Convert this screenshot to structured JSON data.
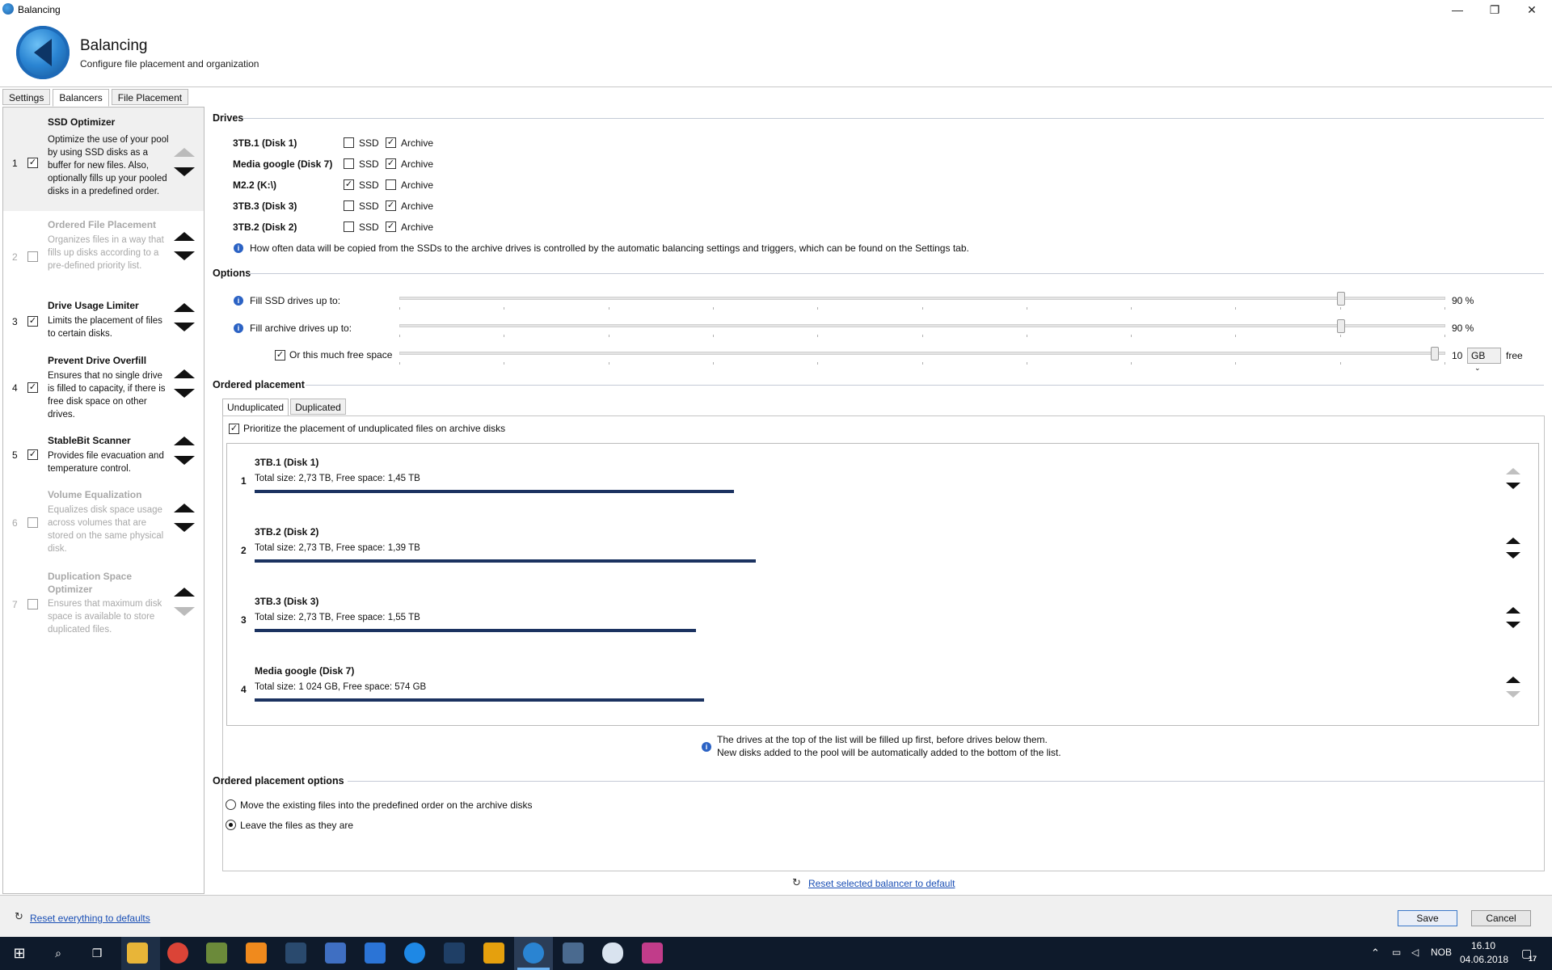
{
  "window": {
    "title": "Balancing",
    "minimize": "—",
    "maximize": "❐",
    "close": "✕"
  },
  "header": {
    "title": "Balancing",
    "subtitle": "Configure file placement and organization"
  },
  "tabs": [
    "Settings",
    "Balancers",
    "File Placement"
  ],
  "active_tab": "Balancers",
  "balancers": [
    {
      "num": "1",
      "title": "SSD Optimizer",
      "desc": "Optimize the use of your pool by using SSD disks as a buffer for new files. Also, optionally fills up your pooled disks in a predefined order.",
      "checked": true,
      "enabled": true
    },
    {
      "num": "2",
      "title": "Ordered File Placement",
      "desc": "Organizes files in a way that fills up disks according to a pre-defined priority list.",
      "checked": false,
      "enabled": false
    },
    {
      "num": "3",
      "title": "Drive Usage Limiter",
      "desc": "Limits the placement of files to certain disks.",
      "checked": true,
      "enabled": true
    },
    {
      "num": "4",
      "title": "Prevent Drive Overfill",
      "desc": "Ensures that no single drive is filled to capacity, if there is free disk space on other drives.",
      "checked": true,
      "enabled": true
    },
    {
      "num": "5",
      "title": "StableBit Scanner",
      "desc": "Provides file evacuation and temperature control.",
      "checked": true,
      "enabled": true
    },
    {
      "num": "6",
      "title": "Volume Equalization",
      "desc": "Equalizes disk space usage across volumes that are stored on the same physical disk.",
      "checked": false,
      "enabled": false
    },
    {
      "num": "7",
      "title": "Duplication Space Optimizer",
      "desc": "Ensures that maximum disk space is available to store duplicated files.",
      "checked": false,
      "enabled": false
    }
  ],
  "drives_section": {
    "title": "Drives",
    "ssd_label": "SSD",
    "archive_label": "Archive",
    "drives": [
      {
        "name": "3TB.1 (Disk 1)",
        "ssd": false,
        "archive": true
      },
      {
        "name": "Media google (Disk 7)",
        "ssd": false,
        "archive": true
      },
      {
        "name": "M2.2 (K:\\)",
        "ssd": true,
        "archive": false
      },
      {
        "name": "3TB.3 (Disk 3)",
        "ssd": false,
        "archive": true
      },
      {
        "name": "3TB.2 (Disk 2)",
        "ssd": false,
        "archive": true
      }
    ],
    "note": "How often data will be copied from the SSDs to the archive drives is controlled by the automatic balancing settings and triggers, which can be found on the Settings tab."
  },
  "options_section": {
    "title": "Options",
    "fill_ssd_label": "Fill SSD drives up to:",
    "fill_ssd_value": "90 %",
    "fill_ssd_fraction": 0.9,
    "fill_archive_label": "Fill archive drives up to:",
    "fill_archive_value": "90 %",
    "fill_archive_fraction": 0.9,
    "free_space_label": "Or this much free space",
    "free_space_checked": true,
    "free_space_value": "10",
    "free_space_unit": "GB",
    "free_space_suffix": "free"
  },
  "ordered_placement": {
    "title": "Ordered placement",
    "subtabs": [
      "Unduplicated",
      "Duplicated"
    ],
    "prioritize_label": "Prioritize the placement of unduplicated files on archive disks",
    "prioritize_checked": true,
    "disks": [
      {
        "index": "1",
        "name": "3TB.1 (Disk 1)",
        "size_text": "Total size: 2,73 TB, Free space: 1,45 TB",
        "used_fraction": 0.4689
      },
      {
        "index": "2",
        "name": "3TB.2 (Disk 2)",
        "size_text": "Total size: 2,73 TB, Free space: 1,39 TB",
        "used_fraction": 0.4908
      },
      {
        "index": "3",
        "name": "3TB.3 (Disk 3)",
        "size_text": "Total size: 2,73 TB, Free space: 1,55 TB",
        "used_fraction": 0.4322
      },
      {
        "index": "4",
        "name": "Media google (Disk 7)",
        "size_text": "Total size: 1 024 GB, Free space: 574 GB",
        "used_fraction": 0.4395
      }
    ],
    "note_line1": "The drives at the top of the list will be filled up first, before drives below them.",
    "note_line2": "New disks added to the pool will be automatically added to the bottom of the list."
  },
  "ordered_options": {
    "title": "Ordered placement options",
    "option_move": "Move the existing files into the predefined order on the archive disks",
    "option_leave": "Leave the files as they are",
    "selected": "leave"
  },
  "reset_selected": "Reset selected balancer to default",
  "footer": {
    "reset_all": "Reset everything to defaults",
    "save": "Save",
    "cancel": "Cancel"
  },
  "taskbar": {
    "language": "NOB",
    "time": "16.10",
    "date": "04.06.2018",
    "notifications": "17"
  },
  "colors": {
    "bar": "#1b3260",
    "link": "#1a4fb5",
    "taskbar": "#0e1a2b"
  }
}
